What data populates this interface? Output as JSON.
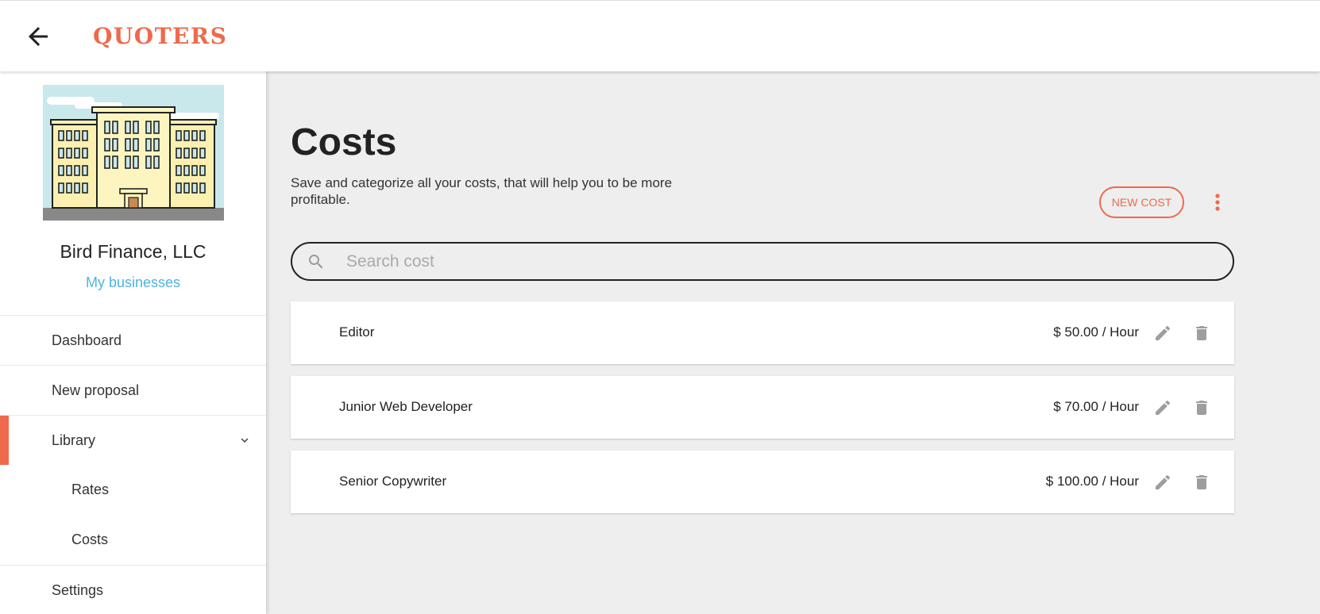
{
  "header": {
    "brand": "QUOTERS",
    "back_icon": "arrow-left-icon"
  },
  "sidebar": {
    "business_name": "Bird Finance, LLC",
    "businesses_link": "My businesses",
    "nav": {
      "dashboard": "Dashboard",
      "new_proposal": "New proposal",
      "library": "Library",
      "rates": "Rates",
      "costs": "Costs",
      "settings": "Settings"
    }
  },
  "main": {
    "title": "Costs",
    "subtitle": "Save and categorize all your costs, that will help you to be more profitable.",
    "new_button": "NEW COST",
    "search_placeholder": "Search cost",
    "items": [
      {
        "name": "Editor",
        "price": "$ 50.00 / Hour"
      },
      {
        "name": "Junior Web Developer",
        "price": "$ 70.00 / Hour"
      },
      {
        "name": "Senior Copywriter",
        "price": "$ 100.00 / Hour"
      }
    ]
  },
  "colors": {
    "accent": "#ee6a4b",
    "link": "#4fb3e0",
    "background": "#eeeeee"
  }
}
